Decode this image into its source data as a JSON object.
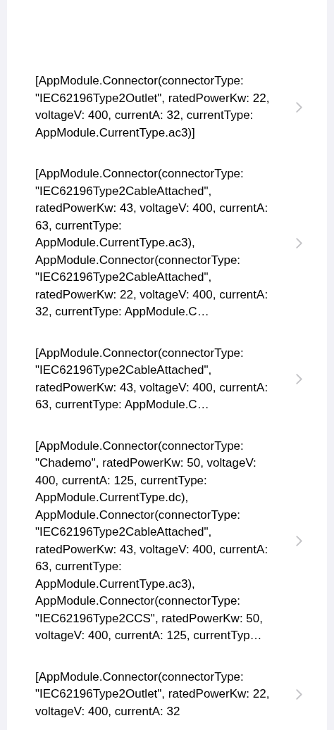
{
  "rows": [
    {
      "text": "[AppModule.Connector(connectorType: \"IEC62196Type2Outlet\", ratedPowerKw: 22, voltageV: 400, currentA: 32, currentType: AppModule.CurrentType.ac3)]"
    },
    {
      "text": "[AppModule.Connector(connectorType: \"IEC62196Type2CableAttached\", ratedPowerKw: 43, voltageV: 400, currentA: 63, currentType: AppModule.CurrentType.ac3), AppModule.Connector(connectorType: \"IEC62196Type2CableAttached\", ratedPowerKw: 22, voltageV: 400, currentA: 32, currentType: AppModule.C…"
    },
    {
      "text": "[AppModule.Connector(connectorType: \"IEC62196Type2CableAttached\", ratedPowerKw: 43, voltageV: 400, currentA: 63, currentType: AppModule.C…"
    },
    {
      "text": "[AppModule.Connector(connectorType: \"Chademo\", ratedPowerKw: 50, voltageV: 400, currentA: 125, currentType: AppModule.CurrentType.dc), AppModule.Connector(connectorType: \"IEC62196Type2CableAttached\", ratedPowerKw: 43, voltageV: 400, currentA: 63, currentType: AppModule.CurrentType.ac3), AppModule.Connector(connectorType: \"IEC62196Type2CCS\", ratedPowerKw: 50, voltageV: 400, currentA: 125, currentTyp…"
    },
    {
      "text": "[AppModule.Connector(connectorType: \"IEC62196Type2Outlet\", ratedPowerKw: 22, voltageV: 400, currentA: 32"
    }
  ]
}
